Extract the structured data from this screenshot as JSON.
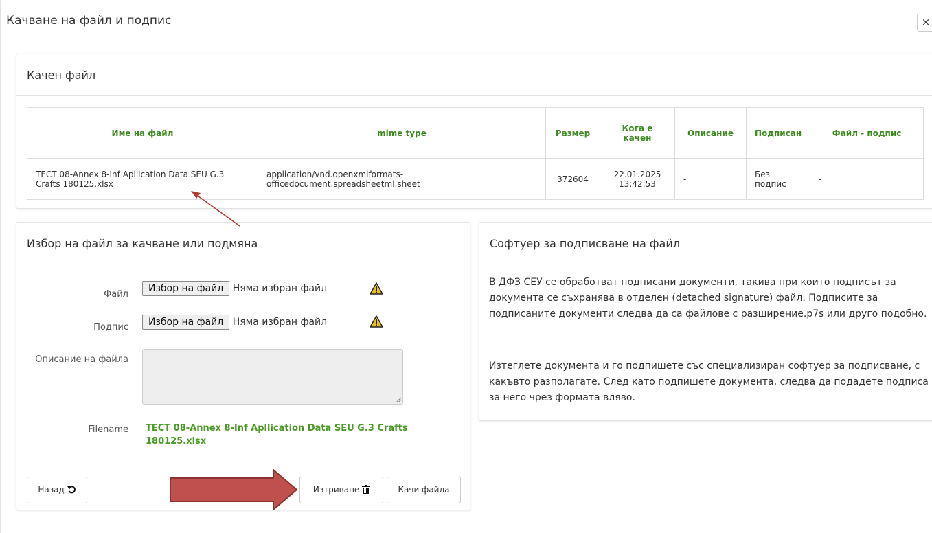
{
  "modal": {
    "title": "Качване на файл и подпис",
    "close_label": "×"
  },
  "uploaded": {
    "heading": "Качен файл",
    "columns": [
      "Име на файл",
      "mime type",
      "Размер",
      "Кога е качен",
      "Описание",
      "Подписан",
      "Файл - подпис"
    ],
    "rows": [
      {
        "name": "ТЕСТ 08-Annex 8-Inf Apllication Data SEU G.3 Crafts 180125.xlsx",
        "mime": "application/vnd.openxmlformats-officedocument.spreadsheetml.sheet",
        "size": "372604",
        "uploaded_at": "22.01.2025 13:42:53",
        "description": "-",
        "signed": "Без подпис",
        "signature_file": "-"
      }
    ]
  },
  "choose": {
    "heading": "Избор на файл за качване или подмяна",
    "file_label": "Файл",
    "signature_label": "Подпис",
    "description_label": "Описание на файла",
    "filename_label": "Filename",
    "choose_button": "Избор на файл",
    "no_file_text": "Няма избран файл",
    "filename_value": "ТЕСТ 08-Annex 8-Inf Apllication Data SEU G.3 Crafts 180125.xlsx",
    "back_button": "Назад",
    "delete_button": "Изтриване",
    "upload_button": "Качи файла",
    "warning_icon": "warning-icon"
  },
  "software": {
    "heading": "Софтуер за подписване на файл",
    "paragraph1": "В ДФЗ СЕУ се обработват подписани документи, такива при които подписът за документа се съхранява в отделен (detached signature) файл. Подписите за подписаните документи следва да са файлове с разширение.p7s или друго подобно.",
    "paragraph2": "Изтеглете документа и го подпишете със специализиран софтуер за подписване, с какъвто разполагате. След като подпишете документа, следва да подадете подписа за него чрез формата вляво."
  },
  "colors": {
    "header_text": "#3c8b1f",
    "filename_text": "#4a9a25",
    "warning": "#e8c21a",
    "annotation_arrow": "#c0504d",
    "annotation_line": "#b03a34"
  }
}
